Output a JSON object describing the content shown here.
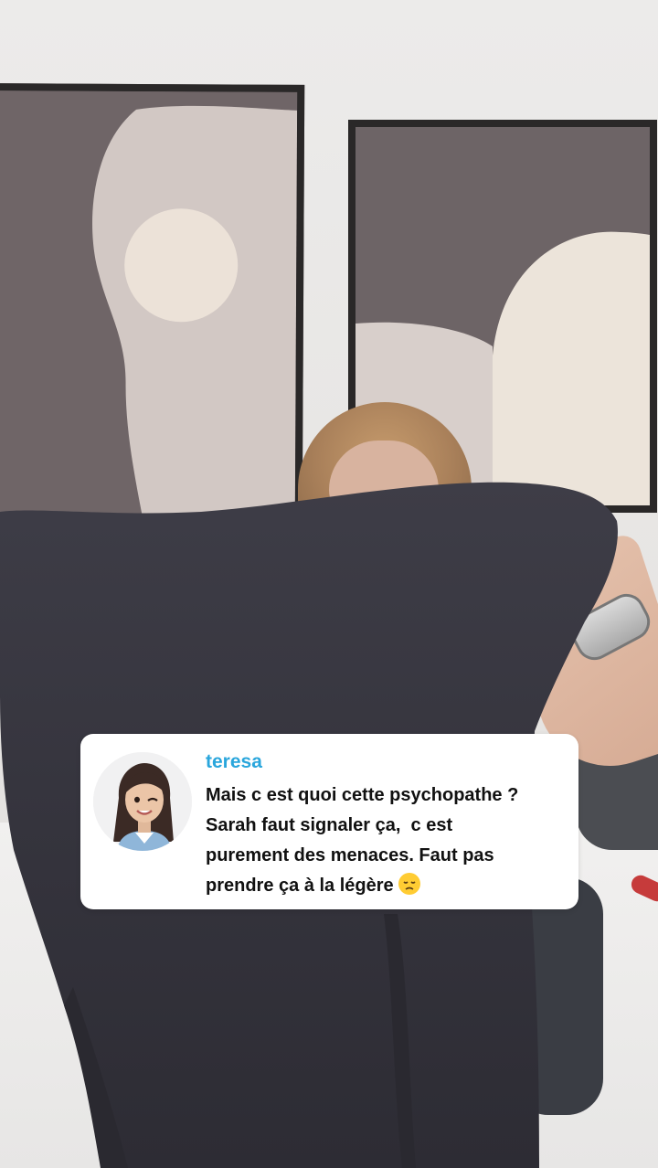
{
  "comment": {
    "username": "teresa",
    "lines": [
      "Mais c est quoi cette psychopathe ?",
      "Sarah faut signaler ça,  c est",
      "purement des menaces. Faut pas",
      "prendre ça à la légère"
    ],
    "emoji": "disappointed-face",
    "avatar": "bitmoji-woman-winking"
  },
  "colors": {
    "username": "#2aa6dc",
    "card_bg": "#ffffff",
    "text": "#111111",
    "garment": "#3a3942",
    "frame_border": "#2a2828"
  }
}
